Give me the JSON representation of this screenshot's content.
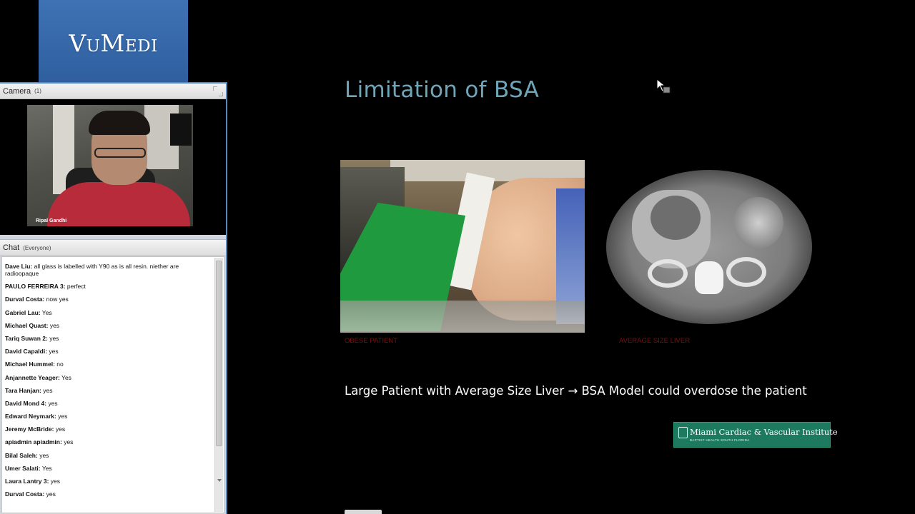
{
  "logo": {
    "text": "VuMedi"
  },
  "camera": {
    "title": "Camera",
    "count": "(1)",
    "participant_name": "Ripal Gandhi"
  },
  "chat": {
    "title": "Chat",
    "scope": "(Everyone)",
    "messages": [
      {
        "sender": "Dave Liu:",
        "text": " all glass is labelled with Y90 as is all resin. niether are radioopaque"
      },
      {
        "sender": "PAULO FERREIRA 3:",
        "text": " perfect"
      },
      {
        "sender": "Durval Costa:",
        "text": " now yes"
      },
      {
        "sender": "Gabriel Lau:",
        "text": " Yes"
      },
      {
        "sender": "Michael Quast:",
        "text": " yes"
      },
      {
        "sender": "Tariq Suwan 2:",
        "text": " yes"
      },
      {
        "sender": "David Capaldi:",
        "text": " yes"
      },
      {
        "sender": "Michael Hummel:",
        "text": " no"
      },
      {
        "sender": "Anjannette Yeager:",
        "text": " Yes"
      },
      {
        "sender": "Tara Hanjan:",
        "text": " yes"
      },
      {
        "sender": "David Mond 4:",
        "text": " yes"
      },
      {
        "sender": "Edward Neymark:",
        "text": " yes"
      },
      {
        "sender": "Jeremy McBride:",
        "text": " yes"
      },
      {
        "sender": "apiadmin apiadmin:",
        "text": " yes"
      },
      {
        "sender": "Bilal Saleh:",
        "text": " yes"
      },
      {
        "sender": "Umer Salati:",
        "text": " Yes"
      },
      {
        "sender": "Laura Lantry 3:",
        "text": " yes"
      },
      {
        "sender": "Durval Costa:",
        "text": " yes"
      }
    ]
  },
  "slide": {
    "title": "Limitation of BSA",
    "caption_left": "OBESE PATIENT",
    "caption_right": "AVERAGE SIZE LIVER",
    "body": "Large Patient with Average Size Liver → BSA Model could overdose the patient",
    "institute_name": "Miami Cardiac & Vascular Institute",
    "institute_sub": "BAPTIST HEALTH SOUTH FLORIDA"
  },
  "colors": {
    "title": "#6fa5b8",
    "caption": "#7a1010",
    "logo_bg": "#3567a8",
    "institute_bg": "#1e7a5e",
    "panel_border": "#5a86c2"
  }
}
